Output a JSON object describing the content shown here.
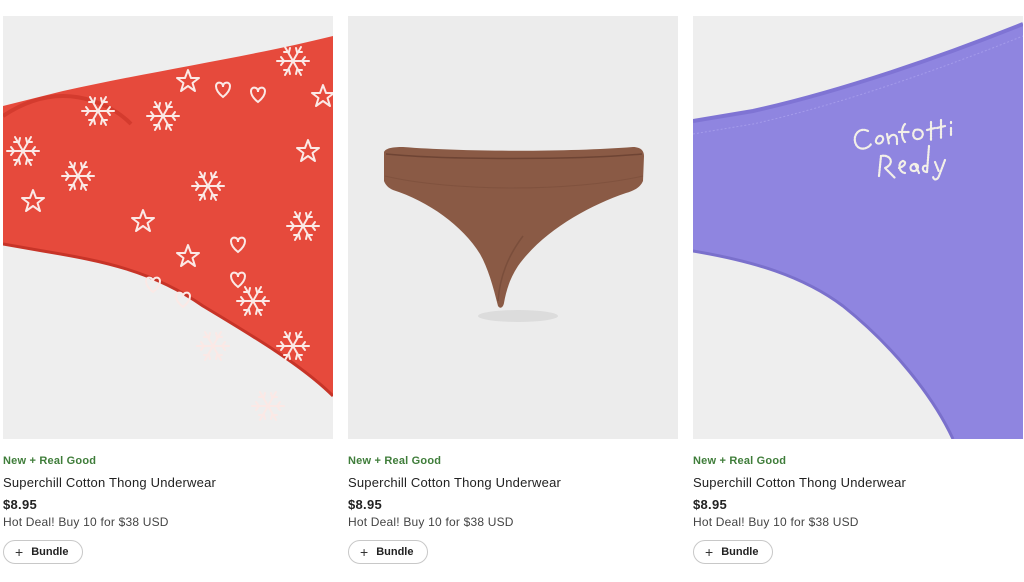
{
  "products": [
    {
      "image_alt": "Red snowflake print thong",
      "badge": "New + Real Good",
      "title": "Superchill Cotton Thong Underwear",
      "price": "$8.95",
      "promo": "Hot Deal! Buy 10 for $38 USD",
      "bundle_label": "Bundle",
      "colors": {
        "fabric": "#e64a3c",
        "background": "#eeeeee"
      }
    },
    {
      "image_alt": "Brown thong",
      "badge": "New + Real Good",
      "title": "Superchill Cotton Thong Underwear",
      "price": "$8.95",
      "promo": "Hot Deal! Buy 10 for $38 USD",
      "bundle_label": "Bundle",
      "colors": {
        "fabric": "#8a5a45",
        "background": "#ececec"
      }
    },
    {
      "image_alt": "Purple thong with Confetti Ready embroidery",
      "badge": "New + Real Good",
      "title": "Superchill Cotton Thong Underwear",
      "price": "$8.95",
      "promo": "Hot Deal! Buy 10 for $38 USD",
      "bundle_label": "Bundle",
      "embroidery": "Confetti Ready",
      "colors": {
        "fabric": "#8f85e0",
        "background": "#eeeeee"
      }
    }
  ],
  "colors": {
    "badge_green": "#3f7d3a",
    "text": "#222222"
  },
  "icons": {
    "bundle": "plus-icon"
  }
}
